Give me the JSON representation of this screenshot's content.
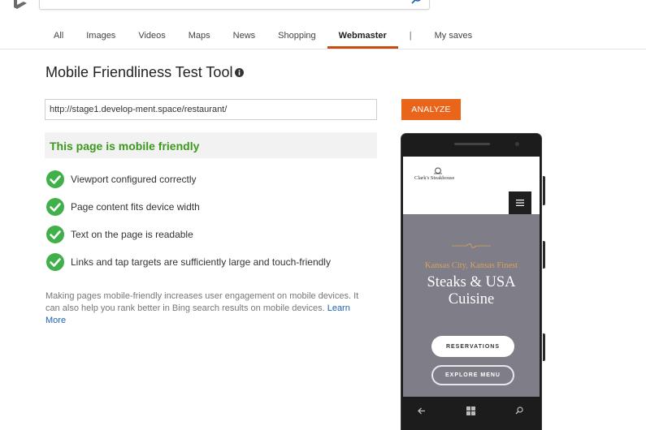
{
  "search": {
    "value": ""
  },
  "tabs": [
    {
      "label": "All"
    },
    {
      "label": "Images"
    },
    {
      "label": "Videos"
    },
    {
      "label": "Maps"
    },
    {
      "label": "News"
    },
    {
      "label": "Shopping"
    },
    {
      "label": "Webmaster",
      "active": true
    },
    {
      "label": "|"
    },
    {
      "label": "My saves"
    }
  ],
  "page": {
    "title": "Mobile Friendliness Test Tool",
    "url_value": "http://stage1.develop-ment.space/restaurant/",
    "analyze_label": "ANALYZE",
    "result": "This page is mobile friendly",
    "checks": [
      {
        "label": "Viewport configured correctly",
        "status": "pass"
      },
      {
        "label": "Page content fits device width",
        "status": "pass"
      },
      {
        "label": "Text on the page is readable",
        "status": "pass"
      },
      {
        "label": "Links and tap targets are sufficiently large and touch-friendly",
        "status": "pass"
      }
    ],
    "note": "Making pages mobile-friendly increases user engagement on mobile devices. It can also help you rank better in Bing search results on mobile devices.",
    "learn_more": "Learn More"
  },
  "preview": {
    "site_name": "Clark's Steakhouse",
    "kicker": "Kansas City, Kansas Finest",
    "headline": "Steaks & USA Cuisine",
    "reservations": "RESERVATIONS",
    "explore": "EXPLORE MENU"
  },
  "colors": {
    "accent": "#e8651a",
    "tab_underline": "#c84b0f",
    "success": "#3c9a1c",
    "check": "#3fb04a",
    "link": "#1e63b5",
    "hero_bg": "#7e7d88",
    "hero_kicker": "#d9a15f"
  },
  "icons": {
    "logo": "bing-logo",
    "search": "search-icon",
    "info": "info-icon",
    "check": "check-circle-icon",
    "menu": "hamburger-icon",
    "back": "back-arrow-icon",
    "windows": "windows-icon",
    "phone_search": "search-icon"
  }
}
